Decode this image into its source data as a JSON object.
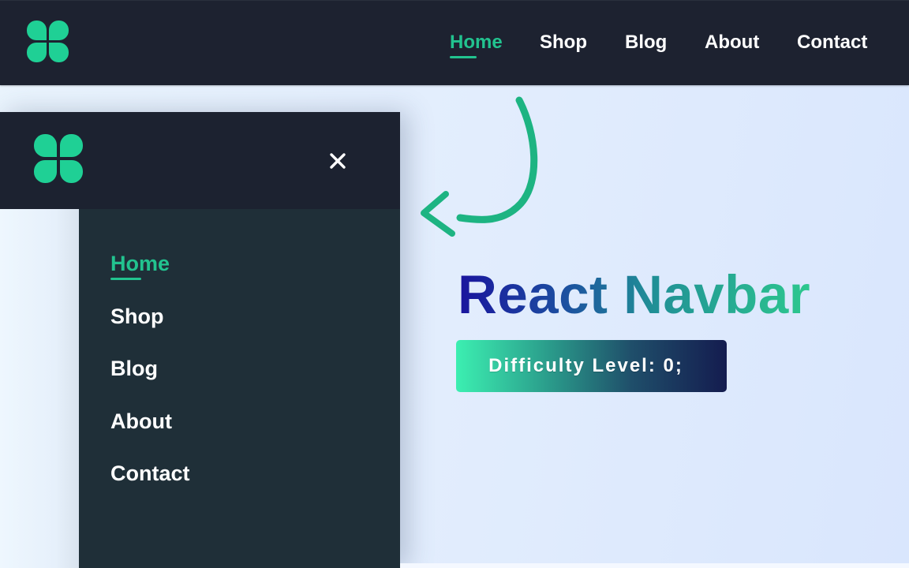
{
  "header": {
    "logo_icon": "four-petal-logo-icon",
    "nav": [
      {
        "label": "Home",
        "active": true
      },
      {
        "label": "Shop",
        "active": false
      },
      {
        "label": "Blog",
        "active": false
      },
      {
        "label": "About",
        "active": false
      },
      {
        "label": "Contact",
        "active": false
      }
    ]
  },
  "drawer": {
    "logo_icon": "four-petal-logo-icon",
    "close_icon": "close-icon",
    "menu": [
      {
        "label": "Home",
        "active": true
      },
      {
        "label": "Shop",
        "active": false
      },
      {
        "label": "Blog",
        "active": false
      },
      {
        "label": "About",
        "active": false
      },
      {
        "label": "Contact",
        "active": false
      }
    ]
  },
  "hero": {
    "title": "React Navbar",
    "badge_label": "Difficulty Level: 0;",
    "annotation_icon": "curved-arrow-icon"
  },
  "colors": {
    "accent": "#22c38f",
    "logo": "#1fd095",
    "header_bg": "#1d2230",
    "drawer_menu_bg": "#1f2f38",
    "page_bg": "#e2edfd",
    "arrow": "#1db482"
  }
}
